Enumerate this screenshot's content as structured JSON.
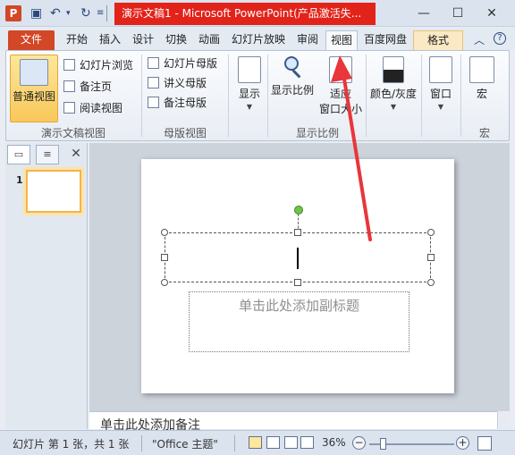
{
  "window": {
    "title": "演示文稿1 - Microsoft PowerPoint(产品激活失...",
    "app_icon": "P",
    "quick_access": [
      "save-icon",
      "undo-icon",
      "redo-icon",
      "customize-icon"
    ],
    "controls": {
      "minimize": "—",
      "maximize": "☐",
      "close": "✕"
    }
  },
  "tabs": [
    {
      "label": "文件"
    },
    {
      "label": "开始"
    },
    {
      "label": "插入"
    },
    {
      "label": "设计"
    },
    {
      "label": "切换"
    },
    {
      "label": "动画"
    },
    {
      "label": "幻灯片放映"
    },
    {
      "label": "审阅"
    },
    {
      "label": "视图",
      "active": true
    },
    {
      "label": "百度网盘"
    },
    {
      "label": "格式"
    }
  ],
  "ribbon": {
    "groups": {
      "presentation_views": {
        "label": "演示文稿视图",
        "normal": "普通视图",
        "slide_sorter": "幻灯片浏览",
        "notes_page": "备注页",
        "reading": "阅读视图"
      },
      "master_views": {
        "label": "母版视图",
        "slide_master": "幻灯片母版",
        "handout_master": "讲义母版",
        "notes_master": "备注母版"
      },
      "show": {
        "label": "显示"
      },
      "zoom": {
        "label": "显示比例",
        "zoom": "显示比例",
        "fit_line1": "适应",
        "fit_line2": "窗口大小"
      },
      "color": {
        "label": "颜色/灰度"
      },
      "window": {
        "label": "窗口"
      },
      "macros": {
        "label": "宏",
        "group_label": "宏"
      }
    }
  },
  "left_pane": {
    "slide_number": "1"
  },
  "slide": {
    "subtitle_placeholder": "单击此处添加副标题"
  },
  "notes": {
    "placeholder": "单击此处添加备注"
  },
  "status": {
    "slide_info": "幻灯片 第 1 张，共 1 张",
    "theme": "\"Office 主题\"",
    "zoom": "36%"
  },
  "colors": {
    "title_highlight": "#e2231a",
    "file_tab": "#d24726",
    "selected_button": "#f9c85a",
    "annotation_arrow": "#e8363a"
  }
}
